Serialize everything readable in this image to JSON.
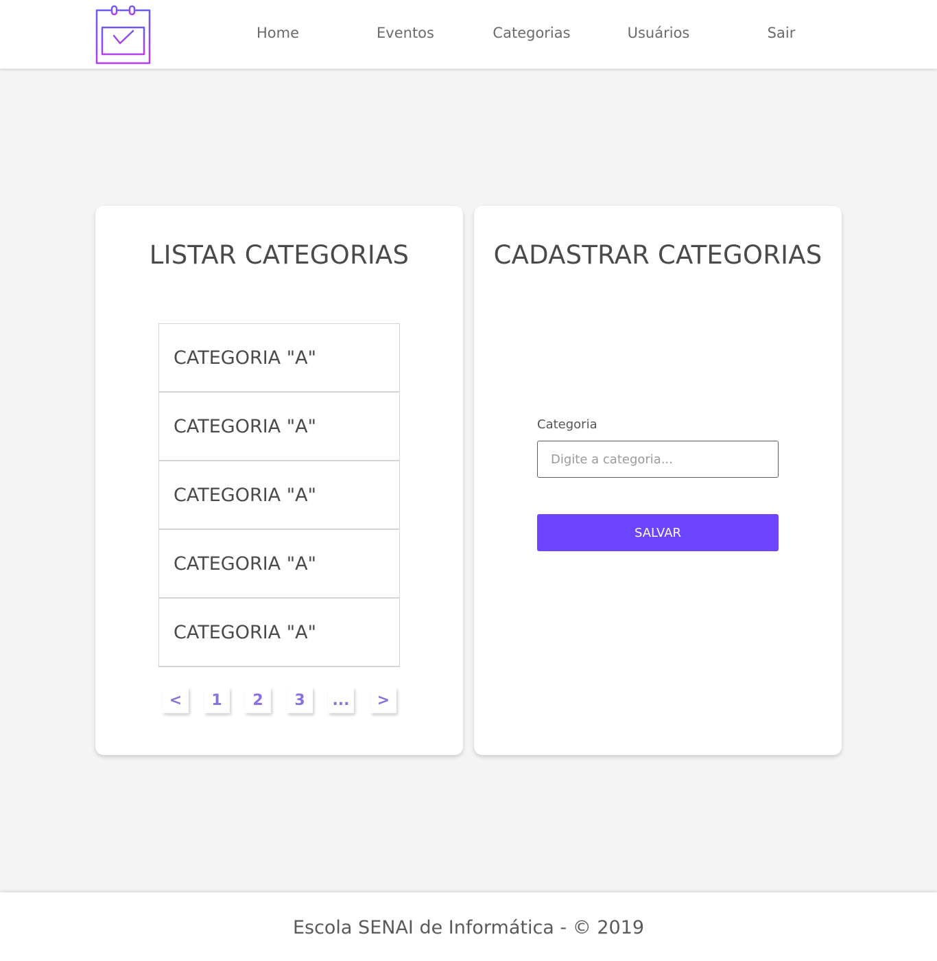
{
  "header": {
    "logo_icon": "calendar-check-icon",
    "nav": {
      "home": "Home",
      "eventos": "Eventos",
      "categorias": "Categorias",
      "usuarios": "Usuários",
      "sair": "Sair"
    }
  },
  "list_card": {
    "title": "LISTAR CATEGORIAS",
    "items": [
      "CATEGORIA \"A\"",
      "CATEGORIA \"A\"",
      "CATEGORIA \"A\"",
      "CATEGORIA \"A\"",
      "CATEGORIA \"A\""
    ],
    "pagination": {
      "prev": "<",
      "pages": [
        "1",
        "2",
        "3"
      ],
      "ellipsis": "...",
      "next": ">"
    }
  },
  "form_card": {
    "title": "CADASTRAR CATEGORIAS",
    "field_label": "Categoria",
    "field_placeholder": "Digite a categoria...",
    "field_value": "",
    "submit_label": "SALVAR"
  },
  "footer": {
    "text": "Escola SENAI de Informática - © 2019"
  },
  "colors": {
    "accent": "#6c44fc",
    "logo_gradient_start": "#6a5cf0",
    "logo_gradient_end": "#b43cf0",
    "page_background": "#f4f4f4",
    "pager_text": "#8a6fe0"
  }
}
